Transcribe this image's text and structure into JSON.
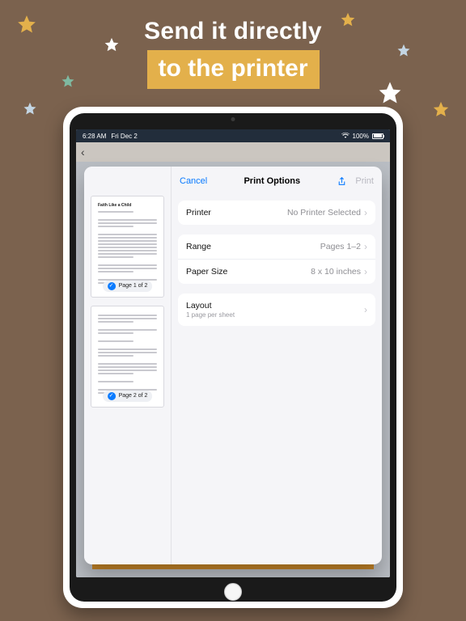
{
  "marketing": {
    "line1": "Send it directly",
    "line2": "to the printer"
  },
  "star_colors": {
    "s1": "#e3b04b",
    "s2": "#7fb9a1",
    "s3": "#ffffff",
    "s4": "#e3b04b",
    "s5": "#c3d5e3",
    "s6": "#ffffff",
    "s7": "#e3b04b",
    "s8": "#c3d5e3"
  },
  "statusbar": {
    "time": "6:28 AM",
    "date": "Fri Dec 2",
    "battery": "100%"
  },
  "modal": {
    "cancel": "Cancel",
    "title": "Print Options",
    "print": "Print",
    "printer": {
      "label": "Printer",
      "value": "No Printer Selected"
    },
    "range": {
      "label": "Range",
      "value": "Pages 1–2"
    },
    "paper": {
      "label": "Paper Size",
      "value": "8 x 10 inches"
    },
    "layout": {
      "label": "Layout",
      "sub": "1 page per sheet"
    }
  },
  "thumbs": {
    "doc_title": "Faith Like a Child",
    "page1": "Page 1 of 2",
    "page2": "Page 2 of 2"
  }
}
